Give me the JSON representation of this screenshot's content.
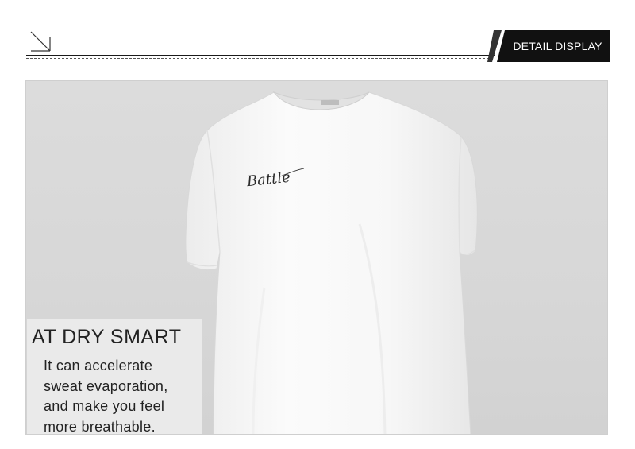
{
  "header": {
    "tag_label": "DETAIL  DISPLAY",
    "corner_icon": "arrow-down-right-icon",
    "accent_color": "#1a1a1a"
  },
  "product": {
    "print_text": "Battle",
    "shirt_color": "#f6f6f6"
  },
  "feature": {
    "title": "AT DRY SMART",
    "lines": [
      "It can accelerate",
      "sweat evaporation,",
      "and make you feel",
      "more breathable."
    ]
  }
}
